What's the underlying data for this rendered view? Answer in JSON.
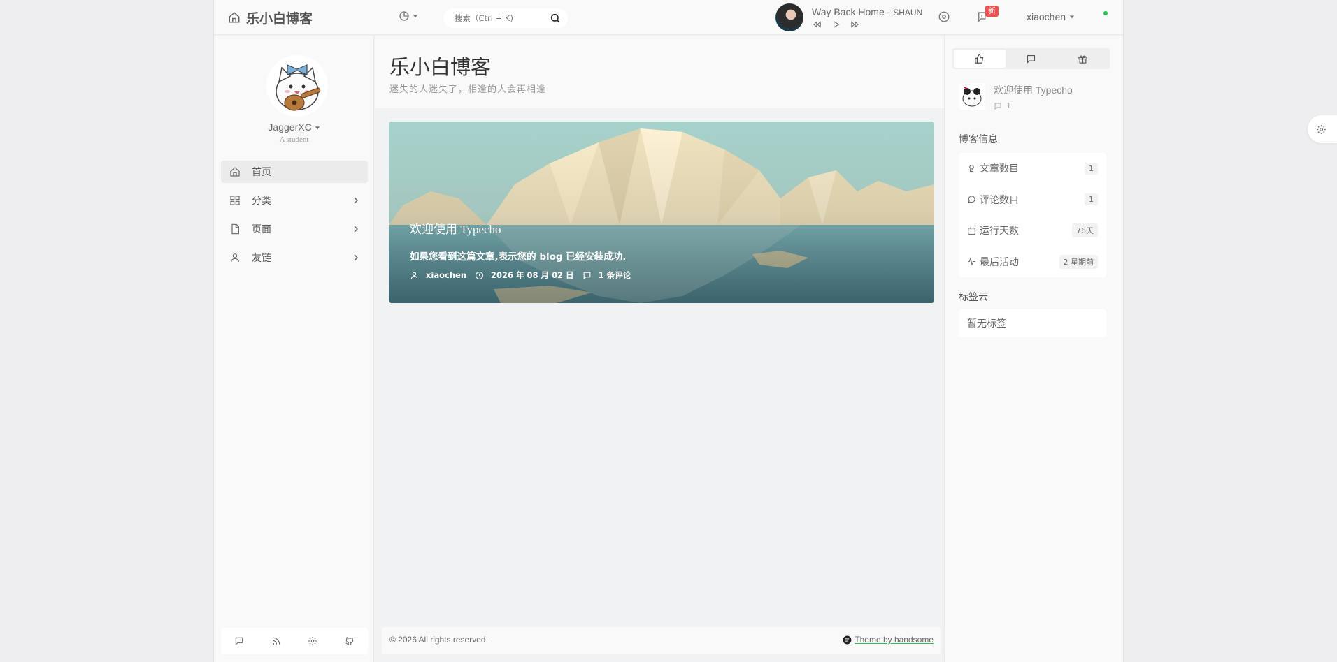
{
  "header": {
    "brand": "乐小白博客",
    "search_placeholder": "搜索（Ctrl + K)",
    "player": {
      "title": "Way Back Home",
      "separator": " - ",
      "artist": "SHAUN"
    },
    "badge": "新",
    "user": "xiaochen"
  },
  "profile": {
    "name": "JaggerXC",
    "subtitle": "A student"
  },
  "nav": [
    {
      "label": "首页"
    },
    {
      "label": "分类"
    },
    {
      "label": "页面"
    },
    {
      "label": "友链"
    }
  ],
  "main": {
    "title": "乐小白博客",
    "subtitle": "迷失的人迷失了，相逢的人会再相逢",
    "post": {
      "title": "欢迎使用 Typecho",
      "excerpt": "如果您看到这篇文章,表示您的 blog 已经安装成功.",
      "author": "xiaochen",
      "date": "2026 年 08 月 02 日",
      "comments": "1 条评论"
    },
    "footer": {
      "copyright": "© 2026 All rights reserved.",
      "theme": "Theme by handsome"
    }
  },
  "sidebar": {
    "recent": {
      "title": "欢迎使用 Typecho",
      "count": "1"
    },
    "blog_info_title": "博客信息",
    "info": [
      {
        "label": "文章数目",
        "value": "1"
      },
      {
        "label": "评论数目",
        "value": "1"
      },
      {
        "label": "运行天数",
        "value": "76天"
      },
      {
        "label": "最后活动",
        "value": "2 星期前"
      }
    ],
    "tags_title": "标签云",
    "tags_empty": "暂无标签"
  },
  "colors": {
    "accent": "#27c24c",
    "badge": "#f05050",
    "card_sky": "#a9d3cd",
    "card_sea": "#5f98a2"
  }
}
